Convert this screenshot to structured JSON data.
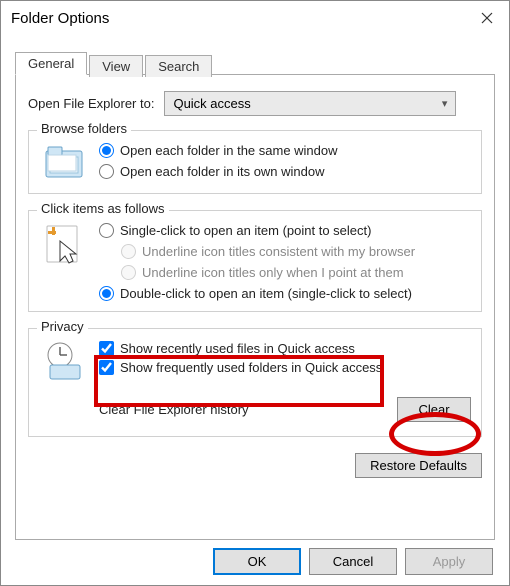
{
  "window": {
    "title": "Folder Options"
  },
  "tabs": [
    "General",
    "View",
    "Search"
  ],
  "open_explorer": {
    "label": "Open File Explorer to:",
    "value": "Quick access"
  },
  "browse": {
    "legend": "Browse folders",
    "opts": [
      "Open each folder in the same window",
      "Open each folder in its own window"
    ]
  },
  "click_items": {
    "legend": "Click items as follows",
    "single": "Single-click to open an item (point to select)",
    "underline_browser": "Underline icon titles consistent with my browser",
    "underline_point": "Underline icon titles only when I point at them",
    "double": "Double-click to open an item (single-click to select)"
  },
  "privacy": {
    "legend": "Privacy",
    "recent_files": "Show recently used files in Quick access",
    "frequent_folders": "Show frequently used folders in Quick access",
    "clear_label": "Clear File Explorer history",
    "clear_btn": "Clear"
  },
  "buttons": {
    "restore": "Restore Defaults",
    "ok": "OK",
    "cancel": "Cancel",
    "apply": "Apply"
  }
}
